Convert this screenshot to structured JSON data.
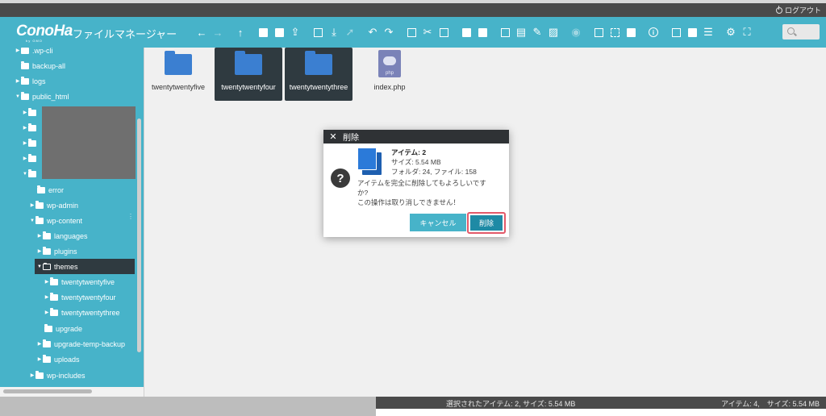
{
  "topbar": {
    "logout_label": "ログアウト"
  },
  "header": {
    "logo": "ConoHa",
    "logo_sub": "by GMO",
    "app_title": "ファイルマネージャー"
  },
  "toolbar": {
    "icons": [
      "arrow-left-icon",
      "arrow-right-icon",
      "arrow-up-icon",
      "new-folder-icon",
      "new-file-icon",
      "upload-icon",
      "folder-outline-icon",
      "download-icon",
      "cursor-icon",
      "undo-icon",
      "redo-icon",
      "copy-icon",
      "cut-icon",
      "paste-icon",
      "trash-icon",
      "trash-alt-icon",
      "duplicate-icon",
      "rename-icon",
      "edit-icon",
      "archive-icon",
      "view-icon",
      "select-all-icon",
      "select-none-icon",
      "invert-selection-icon",
      "info-icon",
      "sort-icon",
      "list-icon",
      "grid-icon",
      "settings-icon",
      "fullscreen-icon"
    ]
  },
  "sidebar": {
    "items": [
      {
        "label": ".wp-cli"
      },
      {
        "label": "backup-all"
      },
      {
        "label": "logs"
      },
      {
        "label": "public_html"
      },
      {
        "label": ""
      },
      {
        "label": ""
      },
      {
        "label": ""
      },
      {
        "label": ""
      },
      {
        "label": ""
      },
      {
        "label": "error"
      },
      {
        "label": "wp-admin"
      },
      {
        "label": "wp-content"
      },
      {
        "label": "languages"
      },
      {
        "label": "plugins"
      },
      {
        "label": "themes"
      },
      {
        "label": "twentytwentyfive"
      },
      {
        "label": "twentytwentyfour"
      },
      {
        "label": "twentytwentythree"
      },
      {
        "label": "upgrade"
      },
      {
        "label": "upgrade-temp-backup"
      },
      {
        "label": "uploads"
      },
      {
        "label": "wp-includes"
      }
    ]
  },
  "files": [
    {
      "name": "twentytwentyfive",
      "type": "folder",
      "selected": false
    },
    {
      "name": "twentytwentyfour",
      "type": "folder",
      "selected": true
    },
    {
      "name": "twentytwentythree",
      "type": "folder",
      "selected": true
    },
    {
      "name": "index.php",
      "type": "php",
      "selected": false,
      "icon_text": "php"
    }
  ],
  "dialog": {
    "title": "削除",
    "items_label": "アイテム: 2",
    "size_label": "サイズ: 5.54 MB",
    "counts_label": "フォルダ: 24, ファイル: 158",
    "message_line1": "アイテムを完全に削除してもよろしいです",
    "message_line2": "か?",
    "message_line3": "この操作は取り消しできません！",
    "cancel_label": "キャンセル",
    "delete_label": "削除"
  },
  "status": {
    "selection": "選択されたアイテム: 2, サイズ: 5.54 MB",
    "total": "アイテム: 4,　サイズ: 5.54 MB"
  }
}
